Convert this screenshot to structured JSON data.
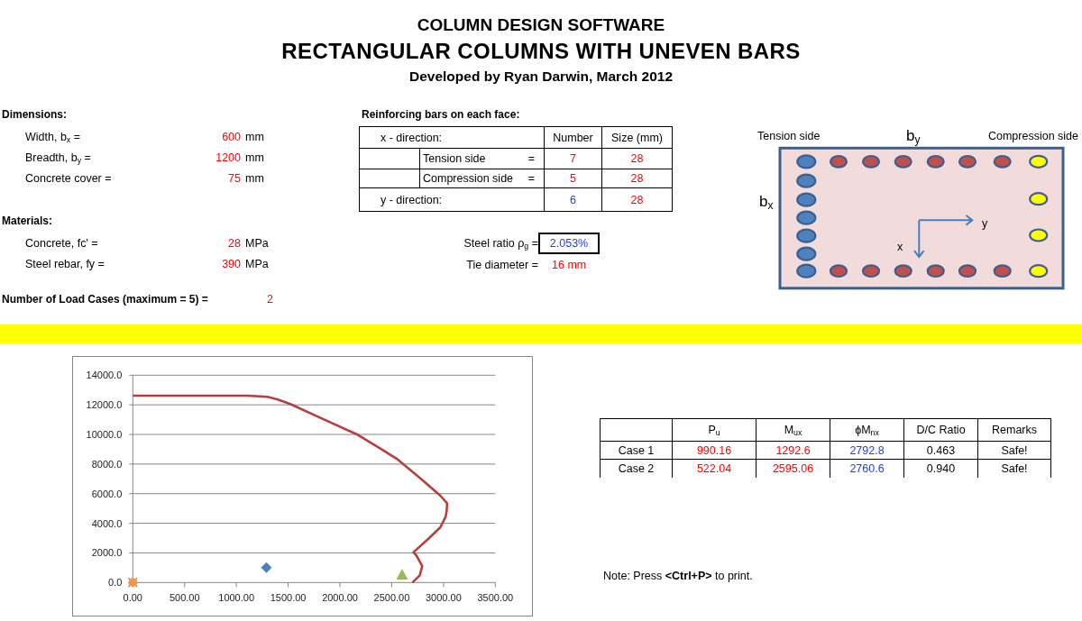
{
  "title": "COLUMN DESIGN SOFTWARE",
  "subtitle": "RECTANGULAR COLUMNS WITH UNEVEN BARS",
  "credit": "Developed by Ryan Darwin, March 2012",
  "input_sections": [
    {
      "heading": "Dimensions:",
      "fields": [
        {
          "label": "Width, b$_{x}$ =",
          "value": "600",
          "unit": "mm"
        },
        {
          "label": "Breadth, b$_{y}$ =",
          "value": "1200",
          "unit": "mm"
        },
        {
          "label": "Concrete cover =",
          "value": "75",
          "unit": "mm"
        }
      ]
    },
    {
      "heading": "Materials:",
      "fields": [
        {
          "label": "Concrete, fc' =",
          "value": "28",
          "unit": "MPa"
        },
        {
          "label": "Steel rebar, fy =",
          "value": "390",
          "unit": "MPa"
        }
      ]
    }
  ],
  "load_cases": {
    "label": "Number of Load Cases (maximum = 5) =",
    "value": "2"
  },
  "reinforcement": {
    "heading": "Reinforcing bars on each face:",
    "table": {
      "x_direction": "x - direction:",
      "columns": [
        "Number",
        "Size (mm)"
      ],
      "x_rows": [
        {
          "label": "Tension side",
          "sign": "=",
          "number": "7",
          "computed": false,
          "size": "28"
        },
        {
          "label": "Compression side",
          "sign": "=",
          "number": "5",
          "computed": false,
          "size": "28"
        }
      ],
      "y_row": {
        "label": "y - direction:",
        "number": "6",
        "computed": true,
        "size": "28"
      }
    },
    "steel_ratio": {
      "label": "Steel ratio ρ$_{g}$ =",
      "value": "2.053%"
    },
    "tie_diameter": {
      "label": "Tie diameter =",
      "value": "16 mm"
    }
  },
  "section_diagram": {
    "tension_label": "Tension side",
    "compression_label": "Compression side",
    "top_dimension": "b$_{y}$",
    "side_dimension": "b$_{x}$",
    "x_axis": "x",
    "y_axis": "y"
  },
  "interaction_chart": {
    "chart_data": [
      {
        "type": "scatter",
        "xlim": [
          0,
          3500
        ],
        "ylim": [
          0,
          14000
        ],
        "xticks": [
          {
            "value": 0,
            "label": "0.00"
          },
          {
            "value": 500,
            "label": "500.00"
          },
          {
            "value": 1000,
            "label": "1000.00"
          },
          {
            "value": 1500,
            "label": "1500.00"
          },
          {
            "value": 2000,
            "label": "2000.00"
          },
          {
            "value": 2500,
            "label": "2500.00"
          },
          {
            "value": 3000,
            "label": "3000.00"
          },
          {
            "value": 3500,
            "label": "3500.00"
          }
        ],
        "yticks": [
          {
            "value": 0,
            "label": "0.0"
          },
          {
            "value": 2000,
            "label": "2000.0"
          },
          {
            "value": 4000,
            "label": "4000.0"
          },
          {
            "value": 6000,
            "label": "6000.0"
          },
          {
            "value": 8000,
            "label": "8000.0"
          },
          {
            "value": 10000,
            "label": "10000.0"
          },
          {
            "value": 12000,
            "label": "12000.0"
          },
          {
            "value": 14000,
            "label": "14000.0"
          }
        ],
        "grid": "y",
        "series": [
          {
            "type": "line",
            "color": "#b5403c",
            "x": [
              0,
              500,
              1110,
              1300,
              1400,
              1520,
              1850,
              2160,
              2400,
              2560,
              2800,
              2970,
              3035,
              3030,
              3020,
              2970,
              2850,
              2710,
              2740,
              2795,
              2770,
              2700
            ],
            "values": [
              12620,
              12620,
              12620,
              12540,
              12360,
              12050,
              11000,
              10020,
              9000,
              8300,
              6900,
              5860,
              5350,
              4800,
              4440,
              3730,
              2920,
              2050,
              1800,
              1100,
              490,
              0
            ]
          },
          {
            "type": "scatter",
            "marker": "diamond",
            "color": "#4f81bd",
            "x": [
              1290
            ],
            "values": [
              1000
            ]
          },
          {
            "type": "scatter",
            "marker": "triangle",
            "color": "#9bbb59",
            "x": [
              2600
            ],
            "values": [
              500
            ]
          },
          {
            "type": "scatter",
            "marker": "x",
            "color": "#4bacc6",
            "x": [
              0
            ],
            "values": [
              0
            ]
          },
          {
            "type": "scatter",
            "marker": "circle",
            "color": "#f79646",
            "x": [
              0
            ],
            "values": [
              0
            ]
          }
        ]
      }
    ]
  },
  "results": {
    "columns": [
      {
        "label": "P$_{u}$",
        "kind": "input"
      },
      {
        "label": "M$_{ux}$",
        "kind": "input"
      },
      {
        "label": "ϕM$_{nx}$",
        "kind": "capacity"
      },
      {
        "label": "D/C Ratio",
        "kind": "plain"
      },
      {
        "label": "Remarks",
        "kind": "plain"
      }
    ],
    "rows": [
      {
        "case": "Case 1",
        "cells": [
          "990.16",
          "1292.6",
          "2792.8",
          "0.463",
          "Safe!"
        ]
      },
      {
        "case": "Case 2",
        "cells": [
          "522.04",
          "2595.06",
          "2760.6",
          "0.940",
          "Safe!"
        ]
      }
    ]
  },
  "note": "Note: Press **<Ctrl+P>** to print."
}
